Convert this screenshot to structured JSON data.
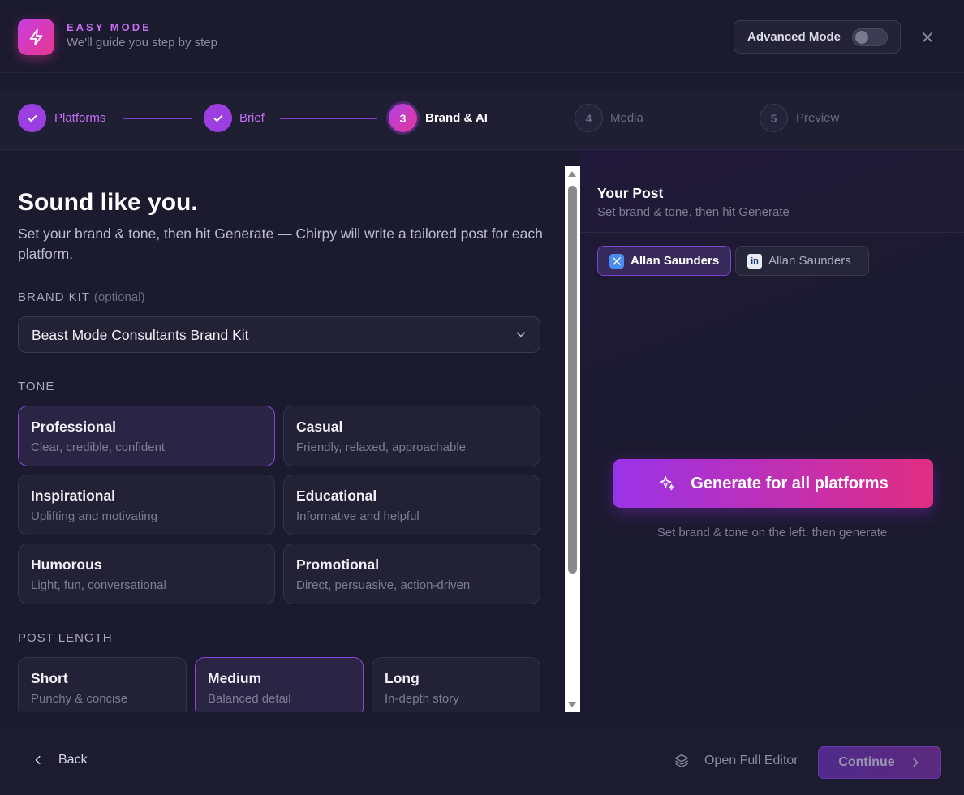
{
  "header": {
    "mode_label": "EASY MODE",
    "mode_subtitle": "We'll guide you step by step",
    "advanced_mode_label": "Advanced Mode",
    "advanced_mode_on": false
  },
  "steps": [
    {
      "number": "1",
      "label": "Platforms",
      "state": "done"
    },
    {
      "number": "2",
      "label": "Brief",
      "state": "done"
    },
    {
      "number": "3",
      "label": "Brand & AI",
      "state": "active"
    },
    {
      "number": "4",
      "label": "Media",
      "state": "todo"
    },
    {
      "number": "5",
      "label": "Preview",
      "state": "todo"
    }
  ],
  "left": {
    "title": "Sound like you.",
    "description": "Set your brand & tone, then hit Generate — Chirpy will write a tailored post for each platform.",
    "brand_kit_label": "BRAND KIT",
    "brand_kit_optional": "(optional)",
    "brand_kit_value": "Beast Mode Consultants Brand Kit",
    "tone_label": "TONE",
    "tones": [
      {
        "title": "Professional",
        "sub": "Clear, credible, confident",
        "selected": true
      },
      {
        "title": "Casual",
        "sub": "Friendly, relaxed, approachable",
        "selected": false
      },
      {
        "title": "Inspirational",
        "sub": "Uplifting and motivating",
        "selected": false
      },
      {
        "title": "Educational",
        "sub": "Informative and helpful",
        "selected": false
      },
      {
        "title": "Humorous",
        "sub": "Light, fun, conversational",
        "selected": false
      },
      {
        "title": "Promotional",
        "sub": "Direct, persuasive, action-driven",
        "selected": false
      }
    ],
    "length_label": "POST LENGTH",
    "lengths": [
      {
        "title": "Short",
        "sub": "Punchy & concise",
        "selected": false
      },
      {
        "title": "Medium",
        "sub": "Balanced detail",
        "selected": true
      },
      {
        "title": "Long",
        "sub": "In-depth story",
        "selected": false
      }
    ]
  },
  "right": {
    "title": "Your Post",
    "subtitle": "Set brand & tone, then hit Generate",
    "accounts": [
      {
        "platform": "x",
        "icon": "x-logo-icon",
        "name": "Allan Saunders",
        "selected": true
      },
      {
        "platform": "linkedin",
        "icon": "linkedin-logo-icon",
        "name": "Allan Saunders",
        "selected": false
      }
    ],
    "generate_label": "Generate for all platforms",
    "generate_hint": "Set brand & tone on the left, then generate"
  },
  "footer": {
    "back_label": "Back",
    "open_editor_label": "Open Full Editor",
    "continue_label": "Continue"
  },
  "colors": {
    "accent_purple": "#9c3fe0",
    "accent_pink": "#e22d83",
    "background": "#1b1a2e"
  }
}
